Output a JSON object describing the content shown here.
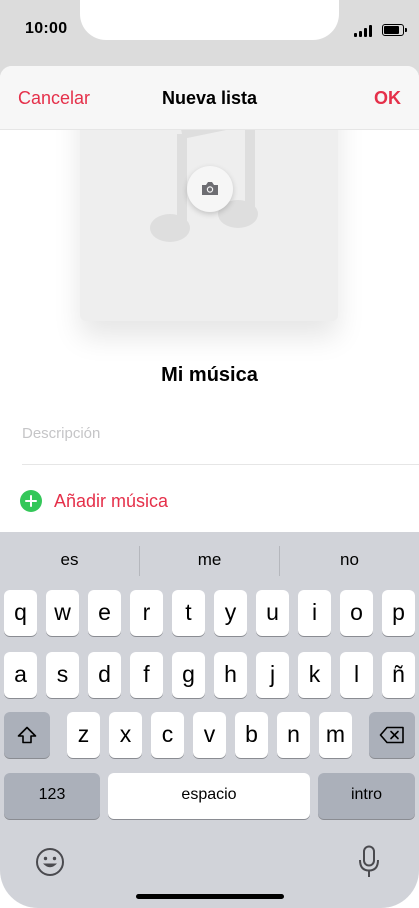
{
  "status_bar": {
    "time": "10:00",
    "battery_level": 0.9
  },
  "nav": {
    "cancel_label": "Cancelar",
    "title": "Nueva lista",
    "ok_label": "OK"
  },
  "artwork": {
    "placeholder_icon": "music-note-icon",
    "camera_icon": "camera-icon"
  },
  "playlist": {
    "name": "Mi música",
    "description_placeholder": "Descripción"
  },
  "add_music": {
    "icon": "plus-circle-icon",
    "label": "Añadir música"
  },
  "keyboard": {
    "suggestions": [
      "es",
      "me",
      "no"
    ],
    "row1": [
      "q",
      "w",
      "e",
      "r",
      "t",
      "y",
      "u",
      "i",
      "o",
      "p"
    ],
    "row2": [
      "a",
      "s",
      "d",
      "f",
      "g",
      "h",
      "j",
      "k",
      "l",
      "ñ"
    ],
    "row3": [
      "z",
      "x",
      "c",
      "v",
      "b",
      "n",
      "m"
    ],
    "numbers_label": "123",
    "space_label": "espacio",
    "return_label": "intro",
    "icons": {
      "shift": "shift-icon",
      "delete": "delete-icon",
      "emoji": "emoji-icon",
      "dictation": "microphone-icon"
    }
  },
  "colors": {
    "accent": "#e5304a",
    "add_green": "#34c759",
    "keyboard_bg": "#d1d3d9"
  }
}
